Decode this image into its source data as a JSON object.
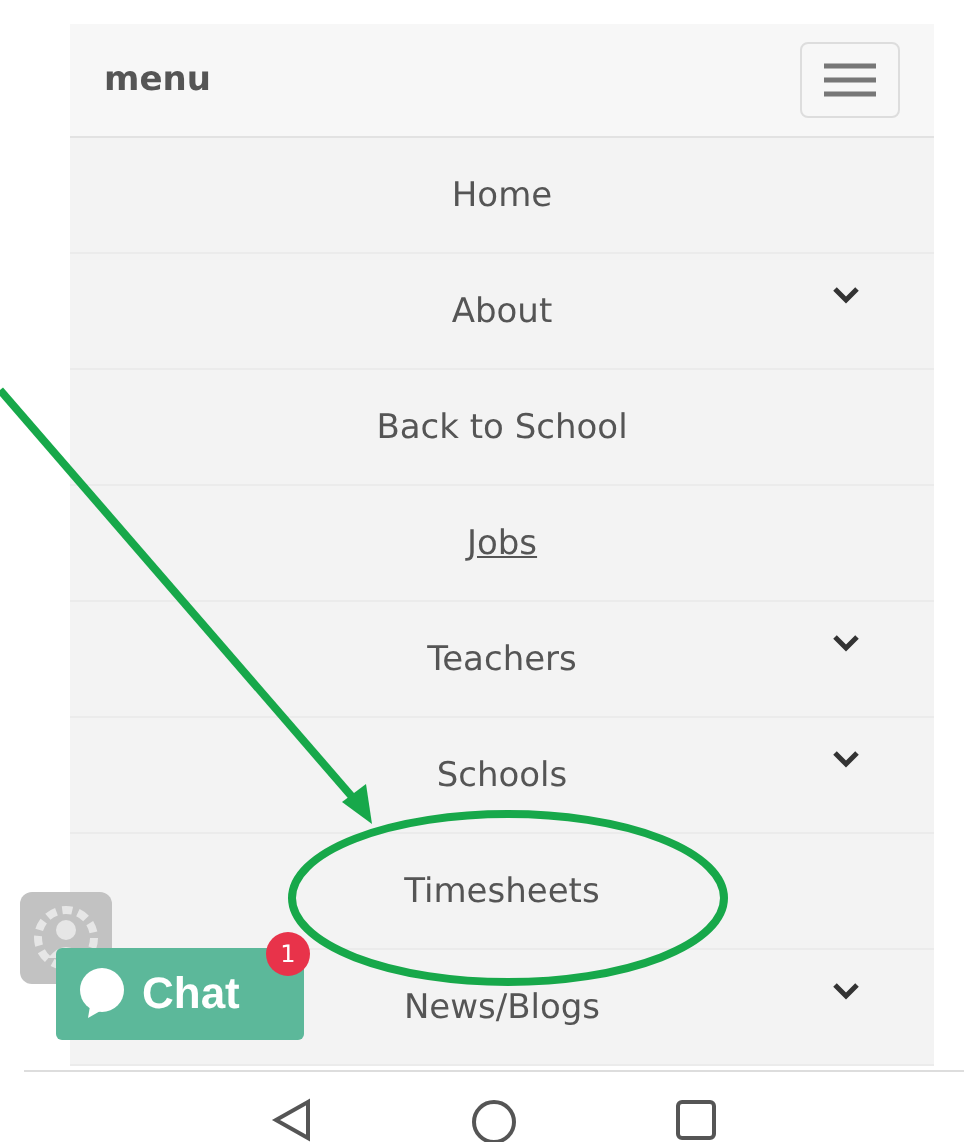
{
  "header": {
    "title": "menu"
  },
  "menu_items": [
    {
      "label": "Home",
      "selected": false,
      "has_submenu": false
    },
    {
      "label": "About",
      "selected": false,
      "has_submenu": true
    },
    {
      "label": "Back to School",
      "selected": false,
      "has_submenu": false
    },
    {
      "label": "Jobs",
      "selected": true,
      "has_submenu": false
    },
    {
      "label": "Teachers",
      "selected": false,
      "has_submenu": true
    },
    {
      "label": "Schools",
      "selected": false,
      "has_submenu": true
    },
    {
      "label": "Timesheets",
      "selected": false,
      "has_submenu": false
    },
    {
      "label": "News/Blogs",
      "selected": false,
      "has_submenu": true
    }
  ],
  "chat_button": {
    "label": "Chat",
    "badge": "1"
  }
}
